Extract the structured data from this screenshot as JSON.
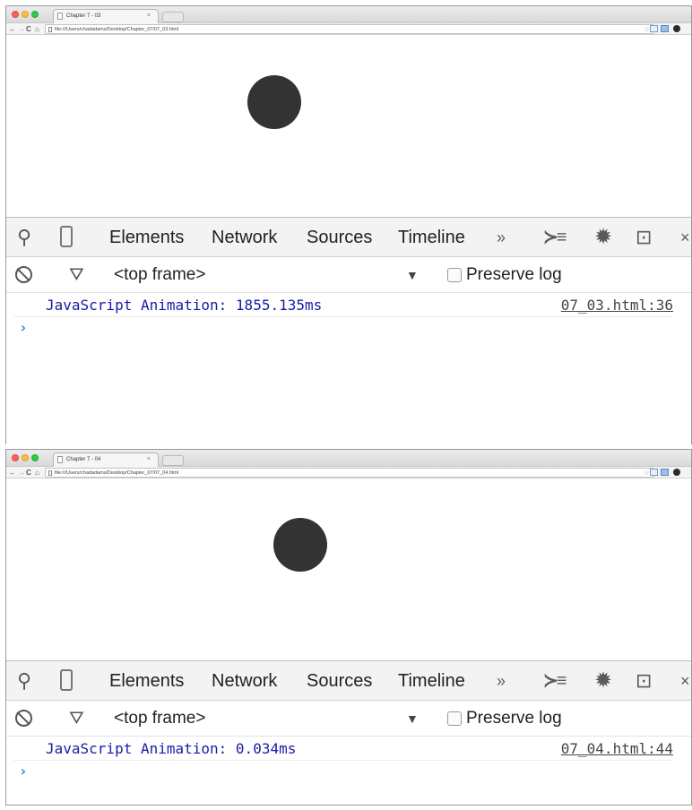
{
  "windows": [
    {
      "tab_title": "Chapter 7 - 03",
      "url": "file:///Users/chadadams/Desktop/Chapter_07/07_03.html",
      "devtools": {
        "tabs": [
          "Elements",
          "Network",
          "Sources",
          "Timeline"
        ],
        "more": "»",
        "frame_selector": "<top frame>",
        "preserve_log": "Preserve log",
        "log_message": "JavaScript Animation: 1855.135ms",
        "log_source": "07_03.html:36",
        "prompt": "›"
      }
    },
    {
      "tab_title": "Chapter 7 - 04",
      "url": "file:///Users/chadadams/Desktop/Chapter_07/07_04.html",
      "devtools": {
        "tabs": [
          "Elements",
          "Network",
          "Sources",
          "Timeline"
        ],
        "more": "»",
        "frame_selector": "<top frame>",
        "preserve_log": "Preserve log",
        "log_message": "JavaScript Animation: 0.034ms",
        "log_source": "07_04.html:44",
        "prompt": "›"
      }
    }
  ],
  "icons": {
    "close_tab": "×",
    "back": "←",
    "forward": "→",
    "reload": "C",
    "home": "⌂",
    "star": "☆",
    "search": "⚲",
    "drawer": "≻≡",
    "gear": "✹",
    "dock": "⊡",
    "close_devtools": "×",
    "funnel": "⛛",
    "dropdown": "▼"
  },
  "colors": {
    "ball": "#333333",
    "log_text": "#1a1aa6",
    "prompt": "#3a7ad8"
  }
}
